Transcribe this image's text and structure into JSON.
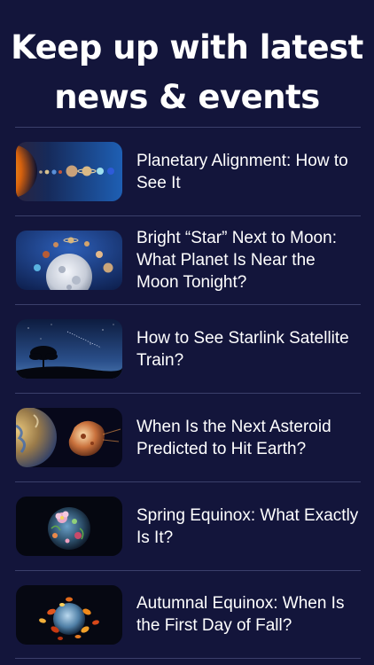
{
  "header": {
    "line1": "Keep up with latest",
    "line2": "news & events"
  },
  "articles": [
    {
      "title": "Planetary Alignment: How to See It",
      "thumbnail_icon": "planets-row-icon"
    },
    {
      "title": "Bright “Star” Next to Moon: What Planet Is Near the Moon Tonight?",
      "thumbnail_icon": "moon-planets-icon"
    },
    {
      "title": "How to See Starlink Satellite Train?",
      "thumbnail_icon": "tree-night-sky-icon"
    },
    {
      "title": "When Is the Next Asteroid Predicted to Hit Earth?",
      "thumbnail_icon": "asteroid-earth-icon"
    },
    {
      "title": "Spring Equinox: What Exactly Is It?",
      "thumbnail_icon": "flower-earth-icon"
    },
    {
      "title": "Autumnal Equinox: When Is the First Day of Fall?",
      "thumbnail_icon": "autumn-leaves-earth-icon"
    }
  ],
  "colors": {
    "background": "#13153b",
    "divider": "#3b3f6b",
    "text": "#ffffff"
  }
}
